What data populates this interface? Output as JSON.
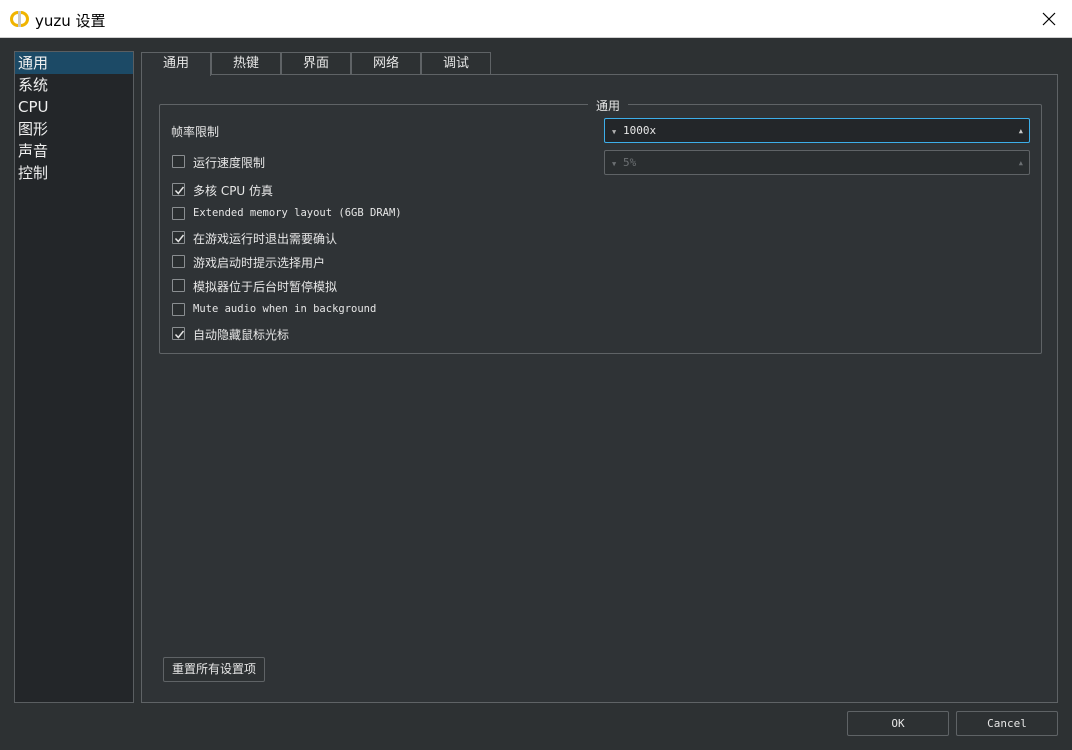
{
  "window": {
    "title": "yuzu 设置"
  },
  "sidebar": {
    "items": [
      {
        "label": "通用",
        "active": true
      },
      {
        "label": "系统",
        "active": false
      },
      {
        "label": "CPU",
        "active": false
      },
      {
        "label": "图形",
        "active": false
      },
      {
        "label": "声音",
        "active": false
      },
      {
        "label": "控制",
        "active": false
      }
    ]
  },
  "tabs": [
    {
      "label": "通用",
      "active": true
    },
    {
      "label": "热键",
      "active": false
    },
    {
      "label": "界面",
      "active": false
    },
    {
      "label": "网络",
      "active": false
    },
    {
      "label": "调试",
      "active": false
    }
  ],
  "group": {
    "title": "通用",
    "frame_limit_label": "帧率限制",
    "frame_limit_value": "1000x",
    "speed_limit_value": "5%"
  },
  "checkboxes": [
    {
      "label": "运行速度限制",
      "checked": false
    },
    {
      "label": "多核 CPU 仿真",
      "checked": true
    },
    {
      "label": "Extended memory layout (6GB DRAM)",
      "checked": false
    },
    {
      "label": "在游戏运行时退出需要确认",
      "checked": true
    },
    {
      "label": "游戏启动时提示选择用户",
      "checked": false
    },
    {
      "label": "模拟器位于后台时暂停模拟",
      "checked": false
    },
    {
      "label": "Mute audio when in background",
      "checked": false
    },
    {
      "label": "自动隐藏鼠标光标",
      "checked": true
    }
  ],
  "buttons": {
    "reset": "重置所有设置项",
    "ok": "OK",
    "cancel": "Cancel"
  },
  "colors": {
    "accent": "#3daee9",
    "selection": "#1c4a66",
    "background": "#2d3133"
  }
}
